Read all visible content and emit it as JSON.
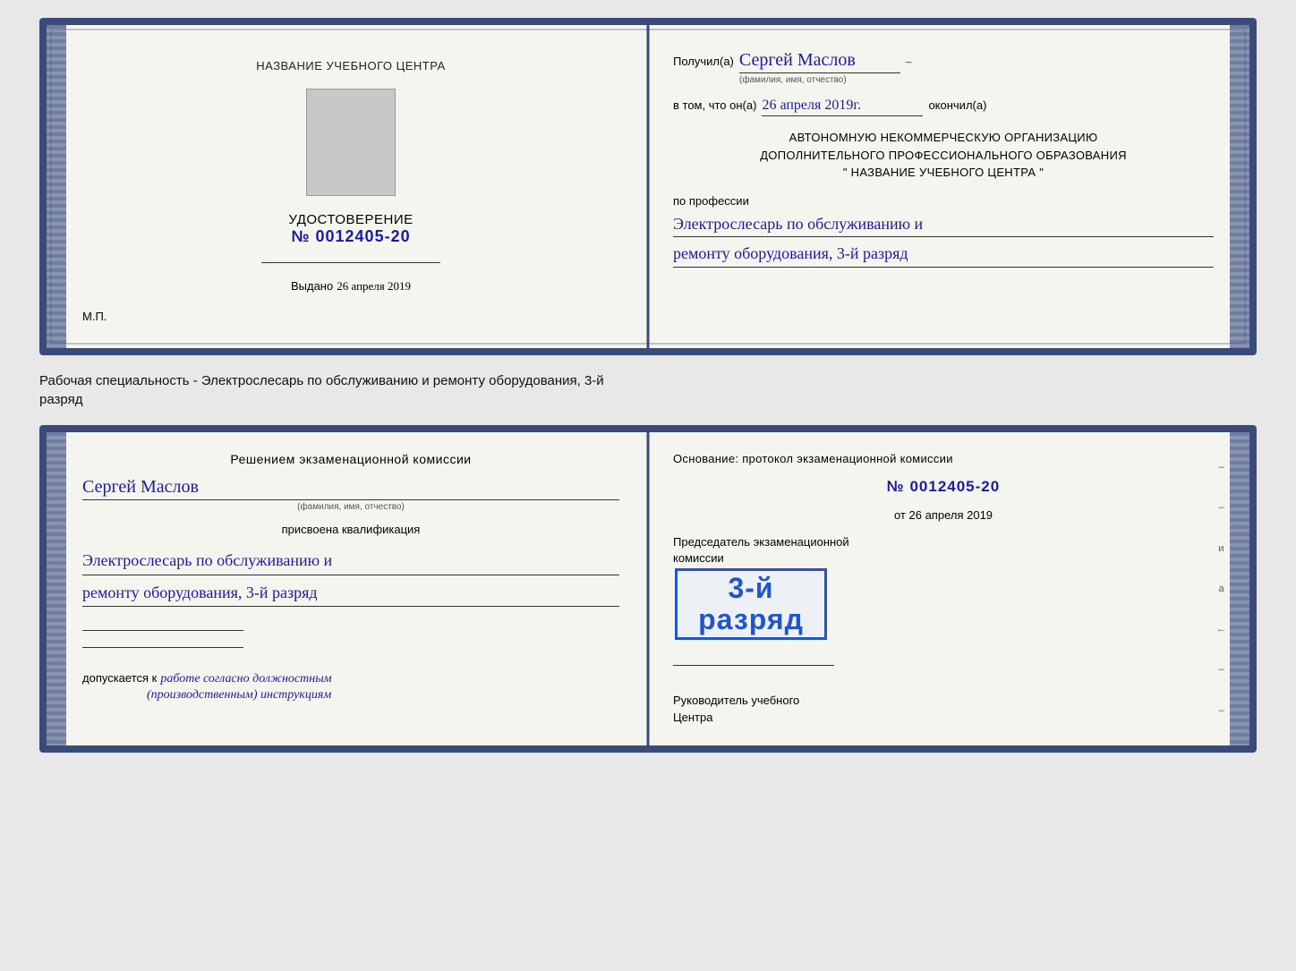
{
  "top_card": {
    "left": {
      "center_name": "НАЗВАНИЕ УЧЕБНОГО ЦЕНТРА",
      "udost_label": "УДОСТОВЕРЕНИЕ",
      "udost_num_prefix": "№",
      "udost_num": "0012405-20",
      "vydano_label": "Выдано",
      "vydano_date": "26 апреля 2019",
      "mp_label": "М.П."
    },
    "right": {
      "poluchil_label": "Получил(а)",
      "poluchil_name": "Сергей Маслов",
      "fio_sub": "(фамилия, имя, отчество)",
      "vtom_label": "в том, что он(а)",
      "vtom_date": "26 апреля 2019г.",
      "okончил_label": "окончил(а)",
      "org_line1": "АВТОНОМНУЮ НЕКОММЕРЧЕСКУЮ ОРГАНИЗАЦИЮ",
      "org_line2": "ДОПОЛНИТЕЛЬНОГО ПРОФЕССИОНАЛЬНОГО ОБРАЗОВАНИЯ",
      "org_line3": "\"    НАЗВАНИЕ УЧЕБНОГО ЦЕНТРА    \"",
      "po_professii_label": "по профессии",
      "profession_line1": "Электрослесарь по обслуживанию и",
      "profession_line2": "ремонту оборудования, 3-й разряд"
    }
  },
  "between_text": {
    "line1": "Рабочая специальность - Электрослесарь по обслуживанию и ремонту оборудования, 3-й",
    "line2": "разряд"
  },
  "bottom_card": {
    "left": {
      "komissia_title": "Решением экзаменационной комиссии",
      "person_name": "Сергей Маслов",
      "fio_sub": "(фамилия, имя, отчество)",
      "prisvoena_label": "присвоена квалификация",
      "qual_line1": "Электрослесарь по обслуживанию и",
      "qual_line2": "ремонту оборудования, 3-й разряд",
      "dopuskaetsya_label": "допускается к",
      "dopuskaetsya_text": "работе согласно должностным",
      "dopuskaetsya_text2": "(производственным) инструкциям"
    },
    "right": {
      "osnovanie_label": "Основание: протокол экзаменационной комиссии",
      "num_prefix": "№",
      "num": "0012405-20",
      "ot_label": "от",
      "ot_date": "26 апреля 2019",
      "predsedatel_line1": "Председатель экзаменационной",
      "predsedatel_line2": "комиссии",
      "stamp_text": "3-й разряд",
      "rukovoditel_line1": "Руководитель учебного",
      "rukovoditel_line2": "Центра"
    }
  },
  "side_annotations": {
    "chars": [
      "и",
      "а",
      "←",
      "–",
      "–",
      "–",
      "–"
    ]
  }
}
